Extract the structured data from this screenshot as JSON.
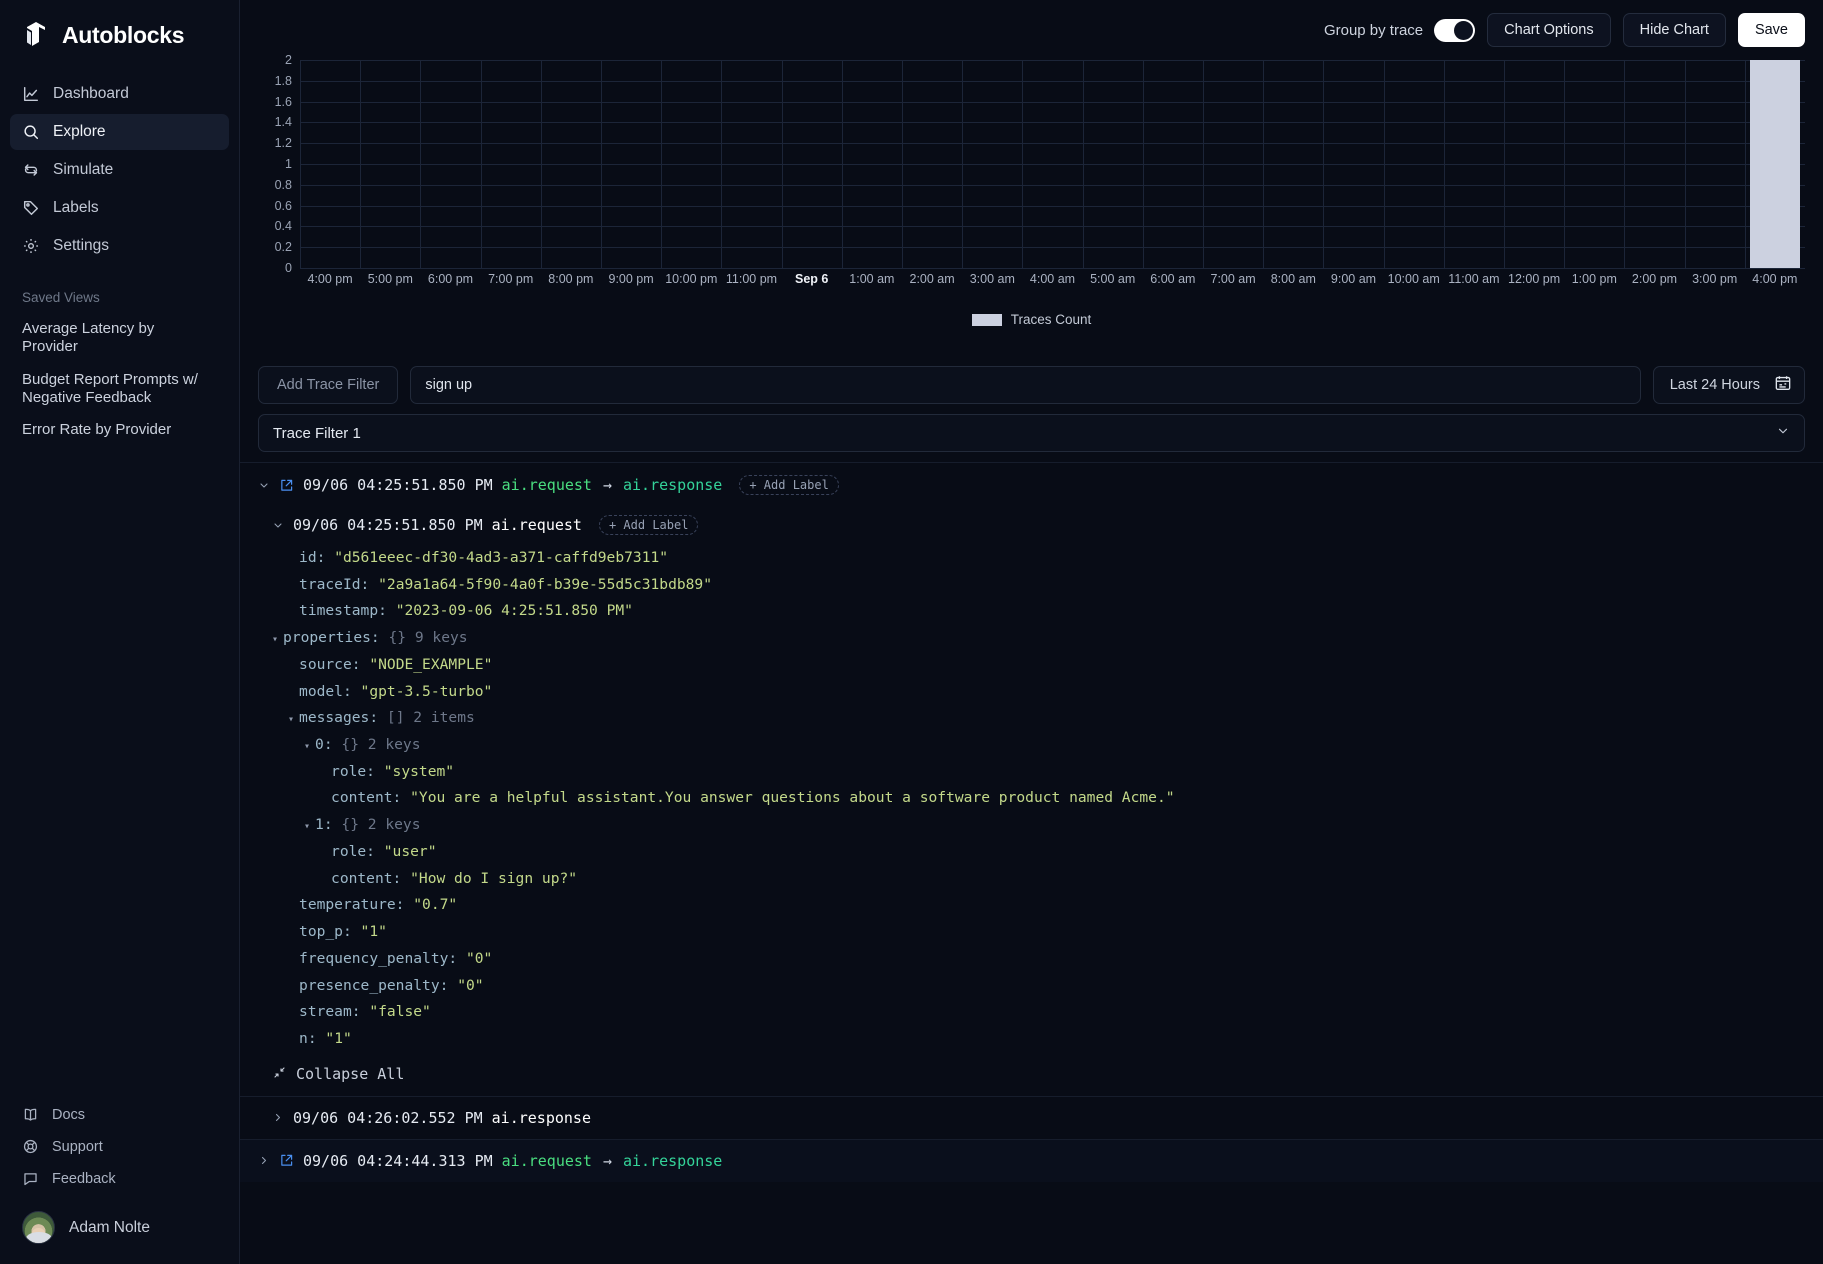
{
  "brand": {
    "name": "Autoblocks",
    "logo_icon": "cube-logo-icon"
  },
  "sidebar": {
    "nav": [
      {
        "label": "Dashboard",
        "icon": "line-chart-icon",
        "active": false
      },
      {
        "label": "Explore",
        "icon": "search-icon",
        "active": true
      },
      {
        "label": "Simulate",
        "icon": "repeat-icon",
        "active": false
      },
      {
        "label": "Labels",
        "icon": "tag-icon",
        "active": false
      },
      {
        "label": "Settings",
        "icon": "gear-icon",
        "active": false
      }
    ],
    "saved_views_header": "Saved Views",
    "saved_views": [
      {
        "label": "Average Latency by Provider"
      },
      {
        "label": "Budget Report Prompts w/ Negative Feedback"
      },
      {
        "label": "Error Rate by Provider"
      }
    ],
    "footer_links": [
      {
        "label": "Docs",
        "icon": "book-icon"
      },
      {
        "label": "Support",
        "icon": "lifebuoy-icon"
      },
      {
        "label": "Feedback",
        "icon": "chat-bubble-icon"
      }
    ],
    "user": {
      "name": "Adam Nolte",
      "avatar_icon": "user-avatar"
    }
  },
  "toolbar": {
    "group_by_trace_label": "Group by trace",
    "group_by_trace_on": true,
    "chart_options_label": "Chart Options",
    "hide_chart_label": "Hide Chart",
    "save_label": "Save"
  },
  "chart_data": {
    "type": "bar",
    "title": "",
    "xlabel": "",
    "ylabel": "",
    "ylim": [
      0,
      2
    ],
    "grid": true,
    "legend_position": "bottom",
    "legend": [
      "Traces Count"
    ],
    "series_color": "#ccd1e0",
    "yticks": [
      "2",
      "1.8",
      "1.6",
      "1.4",
      "1.2",
      "1",
      "0.8",
      "0.6",
      "0.4",
      "0.2",
      "0"
    ],
    "categories": [
      "4:00 pm",
      "5:00 pm",
      "6:00 pm",
      "7:00 pm",
      "8:00 pm",
      "9:00 pm",
      "10:00 pm",
      "11:00 pm",
      "Sep 6",
      "1:00 am",
      "2:00 am",
      "3:00 am",
      "4:00 am",
      "5:00 am",
      "6:00 am",
      "7:00 am",
      "8:00 am",
      "9:00 am",
      "10:00 am",
      "11:00 am",
      "12:00 pm",
      "1:00 pm",
      "2:00 pm",
      "3:00 pm",
      "4:00 pm"
    ],
    "bold_categories": [
      "Sep 6"
    ],
    "values": [
      0,
      0,
      0,
      0,
      0,
      0,
      0,
      0,
      0,
      0,
      0,
      0,
      0,
      0,
      0,
      0,
      0,
      0,
      0,
      0,
      0,
      0,
      0,
      0,
      2
    ],
    "series": [
      {
        "name": "Traces Count",
        "values": [
          0,
          0,
          0,
          0,
          0,
          0,
          0,
          0,
          0,
          0,
          0,
          0,
          0,
          0,
          0,
          0,
          0,
          0,
          0,
          0,
          0,
          0,
          0,
          0,
          2
        ]
      }
    ]
  },
  "filters": {
    "add_trace_filter_label": "Add Trace Filter",
    "search_value": "sign up",
    "search_placeholder": "",
    "date_range_label": "Last 24 Hours",
    "date_range_icon": "calendar-icon",
    "trace_filter_label": "Trace Filter 1",
    "trace_filter_chevron": "chevron-down-icon"
  },
  "traces": [
    {
      "timestamp": "09/06 04:25:51.850 PM",
      "event_from": "ai.request",
      "arrow": "→",
      "event_to": "ai.response",
      "add_label": "+ Add Label",
      "expanded": true,
      "external_icon": "external-link-icon",
      "chevron": "chevron-down-icon",
      "children": [
        {
          "timestamp": "09/06 04:25:51.850 PM",
          "event": "ai.request",
          "add_label": "+ Add Label",
          "expanded": true,
          "json_rows": [
            {
              "indent": 1,
              "toggle": "",
              "key": "id",
              "value": "\"d561eeec-df30-4ad3-a371-caffd9eb7311\"",
              "meta": ""
            },
            {
              "indent": 1,
              "toggle": "",
              "key": "traceId",
              "value": "\"2a9a1a64-5f90-4a0f-b39e-55d5c31bdb89\"",
              "meta": ""
            },
            {
              "indent": 1,
              "toggle": "",
              "key": "timestamp",
              "value": "\"2023-09-06 4:25:51.850 PM\"",
              "meta": ""
            },
            {
              "indent": 0,
              "toggle": "▾",
              "key": "properties",
              "value": "",
              "meta": "{} 9 keys"
            },
            {
              "indent": 1,
              "toggle": "",
              "key": "source",
              "value": "\"NODE_EXAMPLE\"",
              "meta": ""
            },
            {
              "indent": 1,
              "toggle": "",
              "key": "model",
              "value": "\"gpt-3.5-turbo\"",
              "meta": ""
            },
            {
              "indent": 1,
              "toggle": "▾",
              "key": "messages",
              "value": "",
              "meta": "[] 2 items"
            },
            {
              "indent": 2,
              "toggle": "▾",
              "key": "0",
              "value": "",
              "meta": "{} 2 keys"
            },
            {
              "indent": 3,
              "toggle": "",
              "key": "role",
              "value": "\"system\"",
              "meta": ""
            },
            {
              "indent": 3,
              "toggle": "",
              "key": "content",
              "value": "\"You are a helpful assistant.You answer questions about a software product named Acme.\"",
              "meta": ""
            },
            {
              "indent": 2,
              "toggle": "▾",
              "key": "1",
              "value": "",
              "meta": "{} 2 keys"
            },
            {
              "indent": 3,
              "toggle": "",
              "key": "role",
              "value": "\"user\"",
              "meta": ""
            },
            {
              "indent": 3,
              "toggle": "",
              "key": "content",
              "value": "\"How do I sign up?\"",
              "meta": ""
            },
            {
              "indent": 1,
              "toggle": "",
              "key": "temperature",
              "value": "\"0.7\"",
              "meta": ""
            },
            {
              "indent": 1,
              "toggle": "",
              "key": "top_p",
              "value": "\"1\"",
              "meta": ""
            },
            {
              "indent": 1,
              "toggle": "",
              "key": "frequency_penalty",
              "value": "\"0\"",
              "meta": ""
            },
            {
              "indent": 1,
              "toggle": "",
              "key": "presence_penalty",
              "value": "\"0\"",
              "meta": ""
            },
            {
              "indent": 1,
              "toggle": "",
              "key": "stream",
              "value": "\"false\"",
              "meta": ""
            },
            {
              "indent": 1,
              "toggle": "",
              "key": "n",
              "value": "\"1\"",
              "meta": ""
            }
          ],
          "collapse_all_label": "Collapse All",
          "collapse_all_icon": "collapse-icon"
        },
        {
          "timestamp": "09/06 04:26:02.552 PM",
          "event": "ai.response",
          "expanded": false,
          "chevron": "chevron-right-icon"
        }
      ]
    },
    {
      "timestamp": "09/06 04:24:44.313 PM",
      "event_from": "ai.request",
      "arrow": "→",
      "event_to": "ai.response",
      "expanded": false,
      "external_icon": "external-link-icon",
      "chevron": "chevron-right-icon"
    }
  ]
}
